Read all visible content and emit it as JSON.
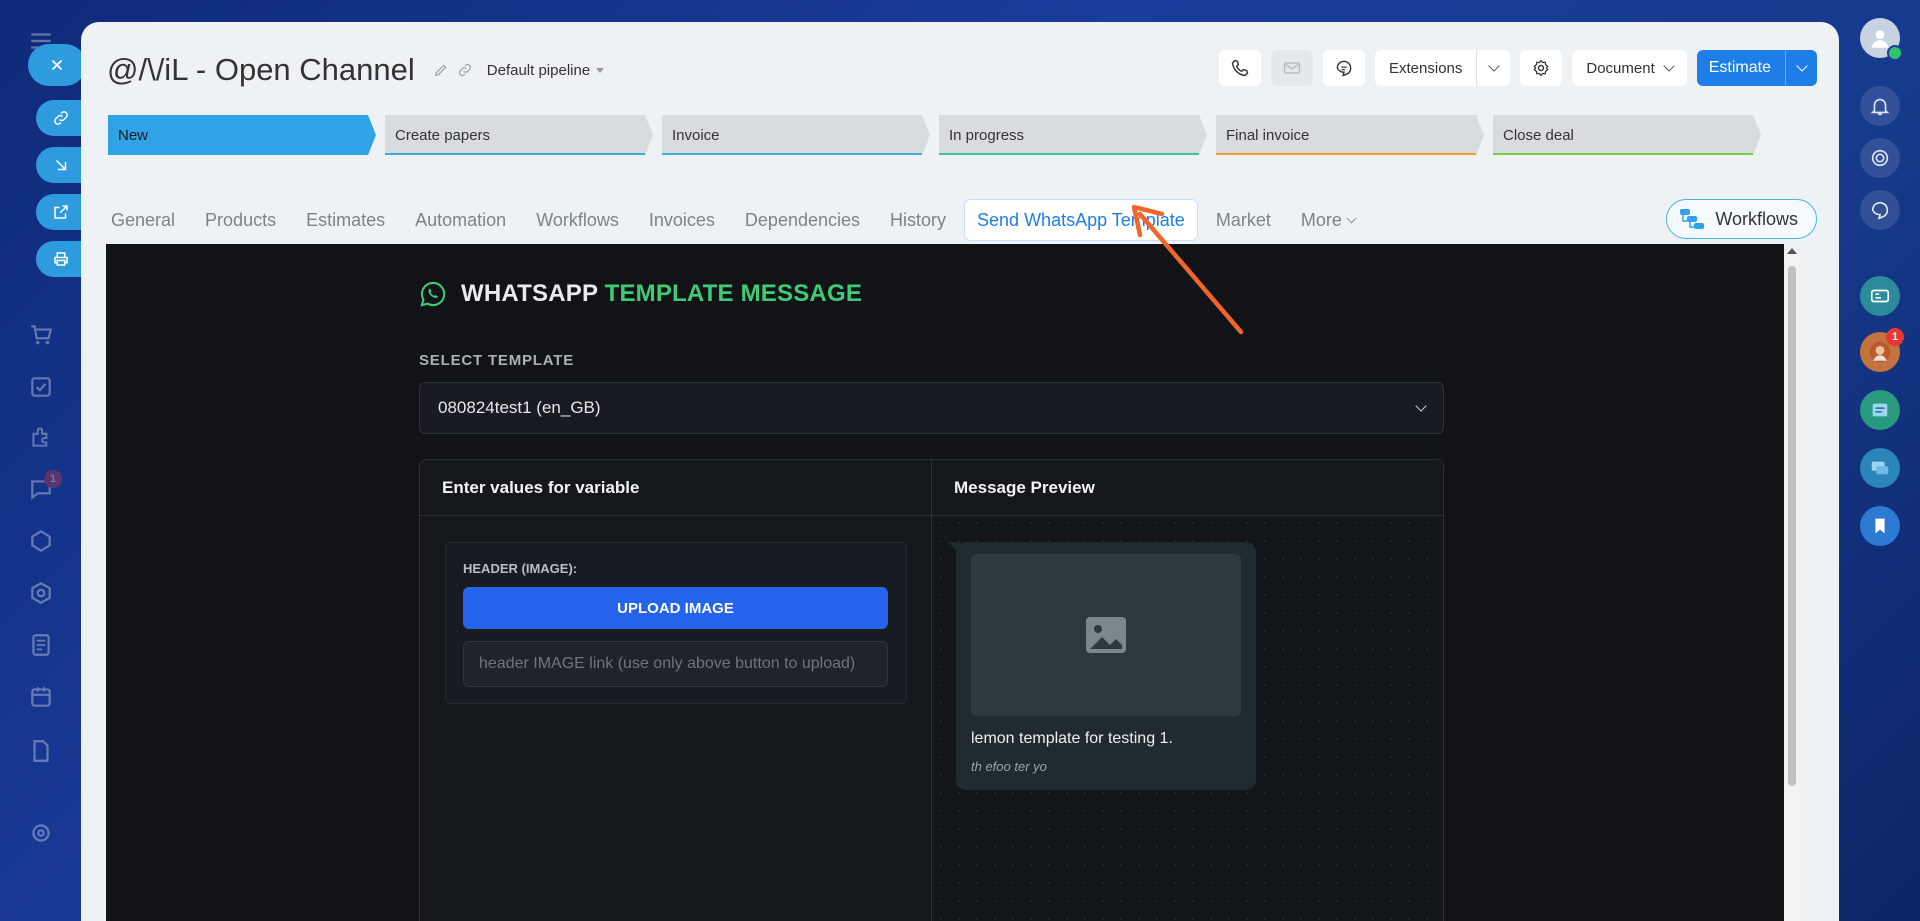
{
  "left_rail": {
    "close_label": "×",
    "badge_count": "1"
  },
  "right_rail": {
    "badge_count": "1"
  },
  "header": {
    "title": "@/\\/iL - Open Channel",
    "pipeline": "Default pipeline",
    "extensions_label": "Extensions",
    "document_label": "Document",
    "estimate_label": "Estimate"
  },
  "stages": [
    {
      "label": "New",
      "color": "#2fa3e6"
    },
    {
      "label": "Create papers",
      "color": "#39a9e0"
    },
    {
      "label": "Invoice",
      "color": "#3cb0d8"
    },
    {
      "label": "In progress",
      "color": "#3fc19f"
    },
    {
      "label": "Final invoice",
      "color": "#f0a02a"
    },
    {
      "label": "Close deal",
      "color": "#7bc843"
    }
  ],
  "tabs": [
    {
      "label": "General"
    },
    {
      "label": "Products"
    },
    {
      "label": "Estimates"
    },
    {
      "label": "Automation"
    },
    {
      "label": "Workflows"
    },
    {
      "label": "Invoices"
    },
    {
      "label": "Dependencies"
    },
    {
      "label": "History"
    },
    {
      "label": "Send WhatsApp Template",
      "active": true
    },
    {
      "label": "Market"
    },
    {
      "label": "More"
    }
  ],
  "workflows_button": "Workflows",
  "whatsapp": {
    "title_part1": "WHATSAPP",
    "title_part2": "TEMPLATE MESSAGE",
    "select_label": "SELECT TEMPLATE",
    "selected_template": "080824test1 (en_GB)",
    "variables_heading": "Enter values for variable",
    "preview_heading": "Message Preview",
    "header_field_label": "HEADER (IMAGE):",
    "upload_button": "UPLOAD IMAGE",
    "link_placeholder": "header IMAGE link (use only above button to upload)",
    "preview_body": "lemon template for testing 1.",
    "preview_footer": "th efoo ter yo"
  },
  "colors": {
    "accent": "#1e7ee8",
    "whatsapp_green": "#3fcb76",
    "annotation_arrow": "#f2642a"
  }
}
